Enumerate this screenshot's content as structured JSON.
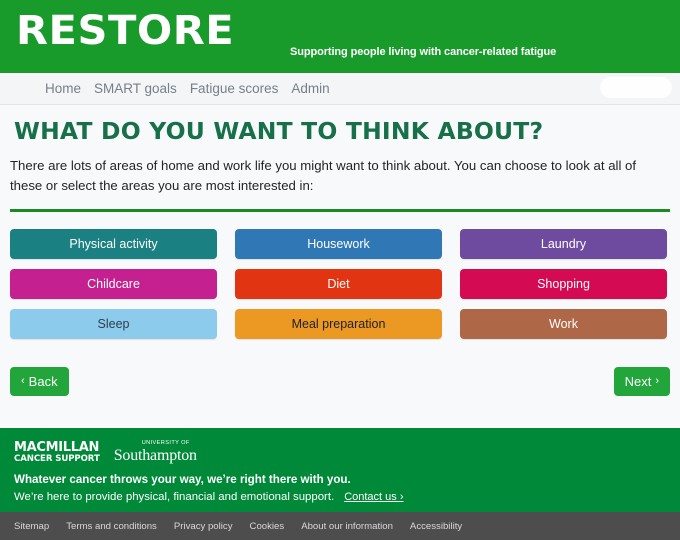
{
  "header": {
    "brand": "RESTORE",
    "tagline": "Supporting people living with cancer-related fatigue",
    "brand_bg": "#199b2c"
  },
  "nav": {
    "items": [
      {
        "label": "Home"
      },
      {
        "label": "SMART goals"
      },
      {
        "label": "Fatigue scores"
      },
      {
        "label": "Admin"
      }
    ]
  },
  "main": {
    "title": "WHAT DO YOU WANT TO THINK ABOUT?",
    "intro": "There are lots of areas of home and work life you might want to think about. You can choose to look at all of these or select the areas you are most interested in:",
    "title_color": "#17704a",
    "divider_color": "#1a8a22",
    "options": [
      {
        "label": "Physical activity",
        "bg": "#1a8082",
        "fg": "#ffffff"
      },
      {
        "label": "Housework",
        "bg": "#2f78b5",
        "fg": "#ffffff"
      },
      {
        "label": "Laundry",
        "bg": "#6f4ba0",
        "fg": "#ffffff"
      },
      {
        "label": "Childcare",
        "bg": "#c4208f",
        "fg": "#ffffff"
      },
      {
        "label": "Diet",
        "bg": "#e03412",
        "fg": "#ffffff"
      },
      {
        "label": "Shopping",
        "bg": "#d40a52",
        "fg": "#ffffff"
      },
      {
        "label": "Sleep",
        "bg": "#8ccbeb",
        "fg": "#2c3e50"
      },
      {
        "label": "Meal preparation",
        "bg": "#eb9923",
        "fg": "#222222"
      },
      {
        "label": "Work",
        "bg": "#ae6848",
        "fg": "#ffffff"
      }
    ]
  },
  "pager": {
    "back_label": "Back",
    "next_label": "Next",
    "back_chevron": "‹",
    "next_chevron": "›",
    "button_color": "#22a53a"
  },
  "footer": {
    "bg": "#008938",
    "macmillan_line1": "MACMILLAN",
    "macmillan_line2": "CANCER SUPPORT",
    "southampton_line1": "UNIVERSITY OF",
    "southampton_line2": "Southampton",
    "headline": "Whatever cancer throws your way, we’re right there with you.",
    "subline": "We’re here to provide physical, financial and emotional support.",
    "contact_label": "Contact us ›"
  },
  "bottombar": {
    "bg": "#4d4d4d",
    "links": [
      {
        "label": "Sitemap"
      },
      {
        "label": "Terms and conditions"
      },
      {
        "label": "Privacy policy"
      },
      {
        "label": "Cookies"
      },
      {
        "label": "About our information"
      },
      {
        "label": "Accessibility"
      }
    ]
  }
}
